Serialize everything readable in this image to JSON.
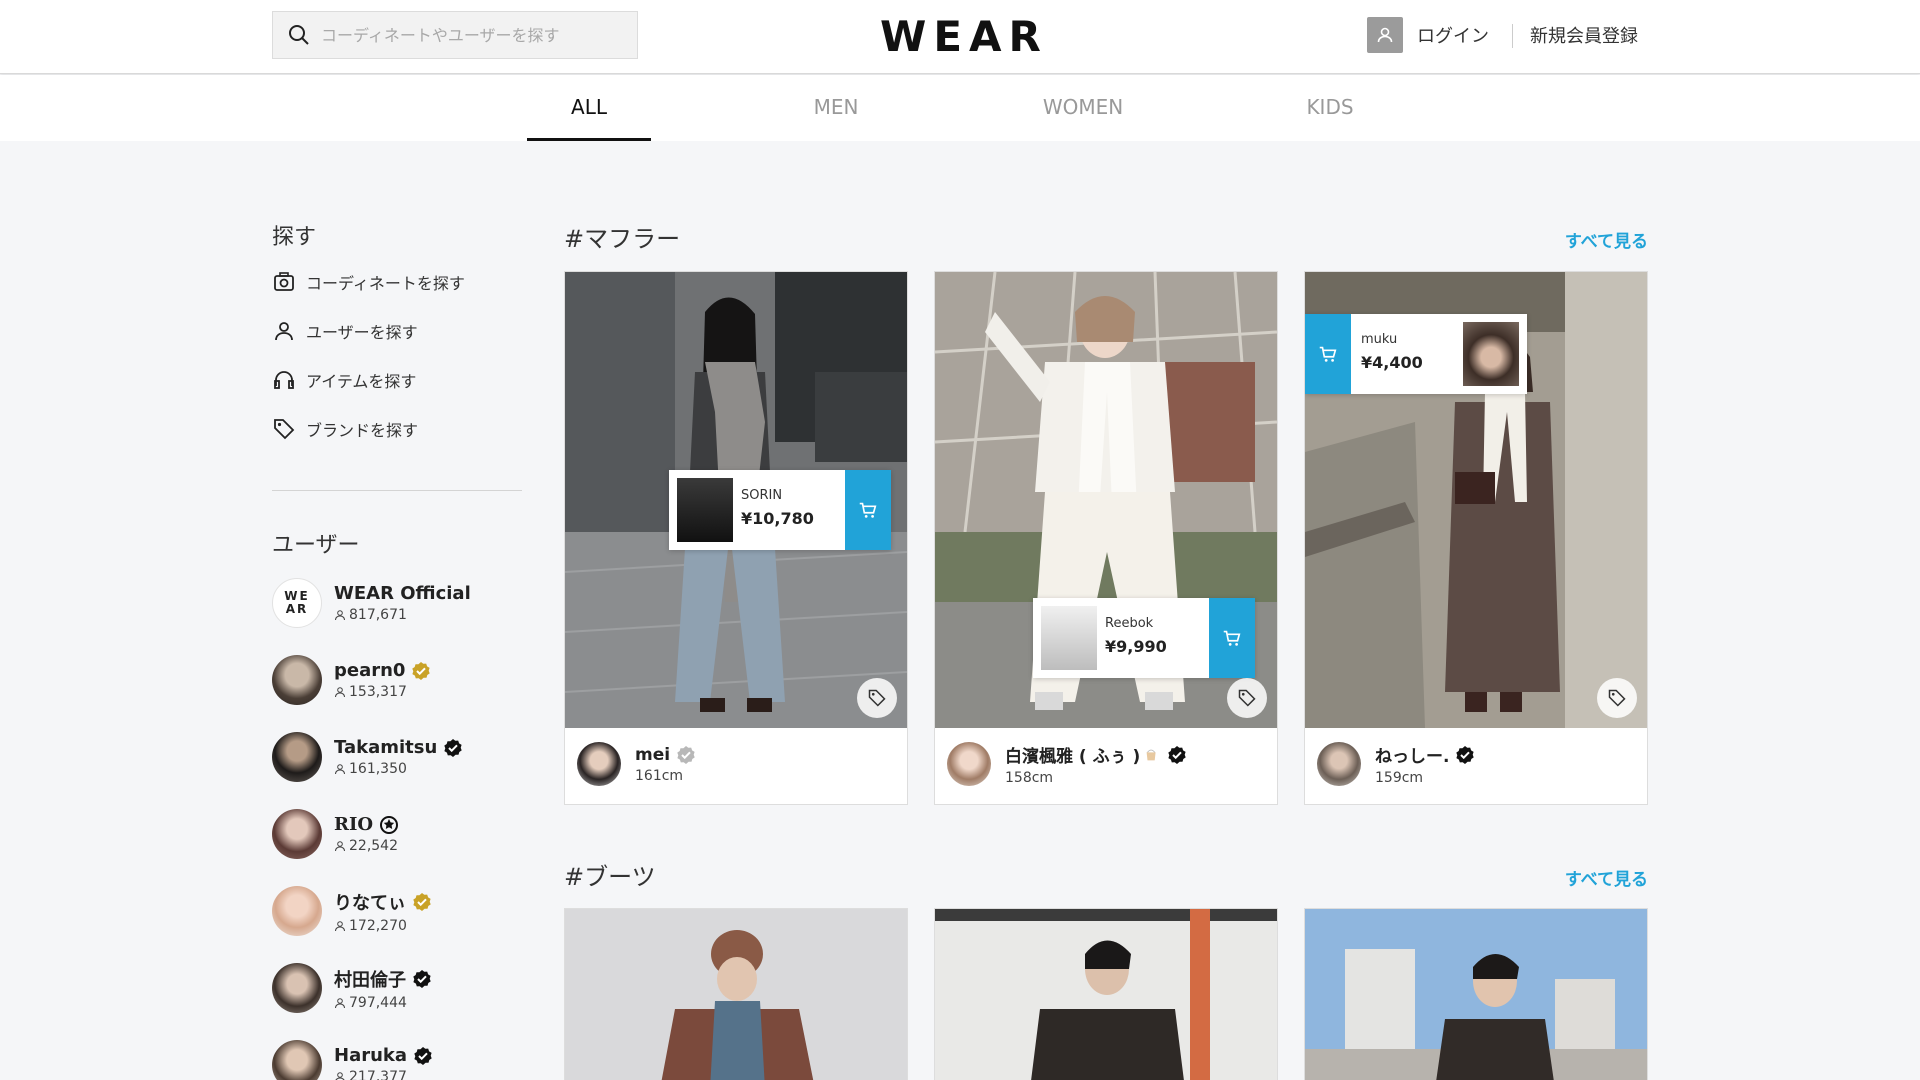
{
  "header": {
    "search_placeholder": "コーディネートやユーザーを探す",
    "logo": "WEAR",
    "login": "ログイン",
    "register": "新規会員登録"
  },
  "tabs": [
    "ALL",
    "MEN",
    "WOMEN",
    "KIDS"
  ],
  "sidebar": {
    "search_title": "探す",
    "nav": [
      "コーディネートを探す",
      "ユーザーを探す",
      "アイテムを探す",
      "ブランドを探す"
    ],
    "users_title": "ユーザー",
    "users": [
      {
        "name": "WEAR Official",
        "count": "817,671",
        "avatar_text": "WE AR"
      },
      {
        "name": "pearn0",
        "count": "153,317"
      },
      {
        "name": "Takamitsu",
        "count": "161,350"
      },
      {
        "name": "RIO",
        "count": "22,542"
      },
      {
        "name": "りなてぃ",
        "count": "172,270"
      },
      {
        "name": "村田倫子",
        "count": "797,444"
      },
      {
        "name": "Haruka",
        "count": "217,377"
      }
    ]
  },
  "sections": [
    {
      "title": "#マフラー",
      "see_all": "すべて見る",
      "cards": [
        {
          "user": "mei",
          "height": "161cm",
          "item_brand": "SORIN",
          "item_price": "¥10,780"
        },
        {
          "user": "白濱楓雅 ( ふぅ )",
          "height": "158cm",
          "item_brand": "Reebok",
          "item_price": "¥9,990"
        },
        {
          "user": "ねっしー.",
          "height": "159cm",
          "item_brand": "muku",
          "item_price": "¥4,400"
        }
      ]
    },
    {
      "title": "#ブーツ",
      "see_all": "すべて見る"
    }
  ],
  "colors": {
    "accent": "#21a3d8",
    "verified_gold": "#c9a227",
    "verified_black": "#111111"
  },
  "icons": [
    "search-icon",
    "user-icon",
    "camera-icon",
    "person-icon",
    "headphones-icon",
    "tag-icon",
    "cart-icon",
    "verified-badge-icon"
  ]
}
